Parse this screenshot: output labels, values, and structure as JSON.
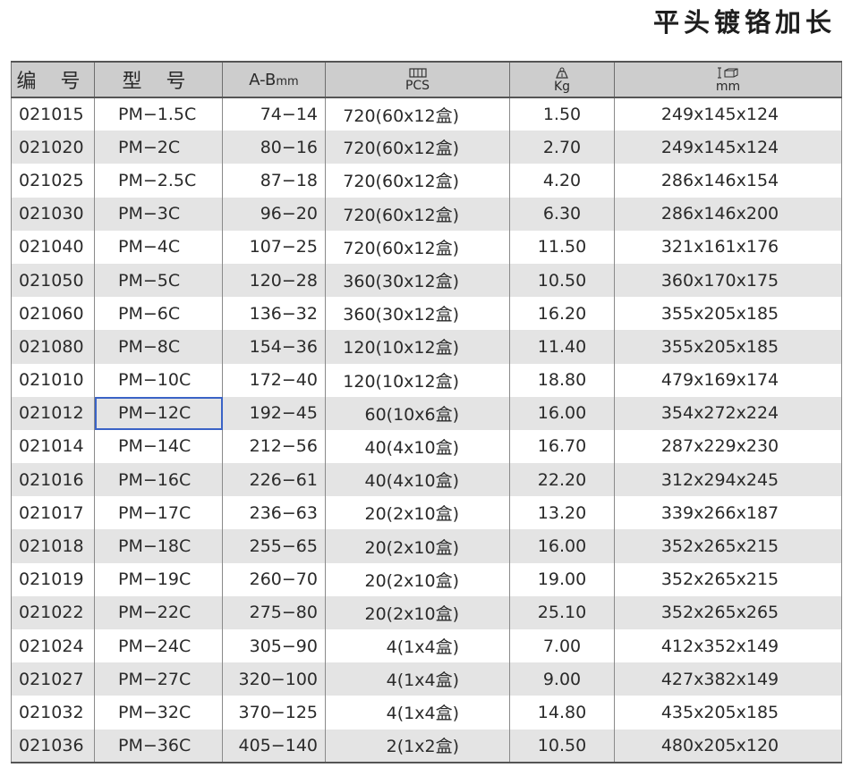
{
  "title": "平头镀铬加长",
  "headers": {
    "code": "编 号",
    "model": "型 号",
    "range_main": "A-B",
    "range_unit": "mm",
    "pcs_icon": "box-stack-icon",
    "pcs": "PCS",
    "kg_icon": "weight-icon",
    "kg": "Kg",
    "dims_icon": "carton-size-icon",
    "dims": "mm"
  },
  "selected_row": 9,
  "rows": [
    {
      "code": "021015",
      "model": "PM−1.5C",
      "range": "74−14",
      "pcs": "720(60x12盒)",
      "kg": "1.50",
      "dims": "249x145x124"
    },
    {
      "code": "021020",
      "model": "PM−2C",
      "range": "80−16",
      "pcs": "720(60x12盒)",
      "kg": "2.70",
      "dims": "249x145x124"
    },
    {
      "code": "021025",
      "model": "PM−2.5C",
      "range": "87−18",
      "pcs": "720(60x12盒)",
      "kg": "4.20",
      "dims": "286x146x154"
    },
    {
      "code": "021030",
      "model": "PM−3C",
      "range": "96−20",
      "pcs": "720(60x12盒)",
      "kg": "6.30",
      "dims": "286x146x200"
    },
    {
      "code": "021040",
      "model": "PM−4C",
      "range": "107−25",
      "pcs": "720(60x12盒)",
      "kg": "11.50",
      "dims": "321x161x176"
    },
    {
      "code": "021050",
      "model": "PM−5C",
      "range": "120−28",
      "pcs": "360(30x12盒)",
      "kg": "10.50",
      "dims": "360x170x175"
    },
    {
      "code": "021060",
      "model": "PM−6C",
      "range": "136−32",
      "pcs": "360(30x12盒)",
      "kg": "16.20",
      "dims": "355x205x185"
    },
    {
      "code": "021080",
      "model": "PM−8C",
      "range": "154−36",
      "pcs": "120(10x12盒)",
      "kg": "11.40",
      "dims": "355x205x185"
    },
    {
      "code": "021010",
      "model": "PM−10C",
      "range": "172−40",
      "pcs": "120(10x12盒)",
      "kg": "18.80",
      "dims": "479x169x174"
    },
    {
      "code": "021012",
      "model": "PM−12C",
      "range": "192−45",
      "pcs": "60(10x6盒)",
      "kg": "16.00",
      "dims": "354x272x224"
    },
    {
      "code": "021014",
      "model": "PM−14C",
      "range": "212−56",
      "pcs": "40(4x10盒)",
      "kg": "16.70",
      "dims": "287x229x230"
    },
    {
      "code": "021016",
      "model": "PM−16C",
      "range": "226−61",
      "pcs": "40(4x10盒)",
      "kg": "22.20",
      "dims": "312x294x245"
    },
    {
      "code": "021017",
      "model": "PM−17C",
      "range": "236−63",
      "pcs": "20(2x10盒)",
      "kg": "13.20",
      "dims": "339x266x187"
    },
    {
      "code": "021018",
      "model": "PM−18C",
      "range": "255−65",
      "pcs": "20(2x10盒)",
      "kg": "16.00",
      "dims": "352x265x215"
    },
    {
      "code": "021019",
      "model": "PM−19C",
      "range": "260−70",
      "pcs": "20(2x10盒)",
      "kg": "19.00",
      "dims": "352x265x215"
    },
    {
      "code": "021022",
      "model": "PM−22C",
      "range": "275−80",
      "pcs": "20(2x10盒)",
      "kg": "25.10",
      "dims": "352x265x265"
    },
    {
      "code": "021024",
      "model": "PM−24C",
      "range": "305−90",
      "pcs": "4(1x4盒)",
      "kg": "7.00",
      "dims": "412x352x149"
    },
    {
      "code": "021027",
      "model": "PM−27C",
      "range": "320−100",
      "pcs": "4(1x4盒)",
      "kg": "9.00",
      "dims": "427x382x149"
    },
    {
      "code": "021032",
      "model": "PM−32C",
      "range": "370−125",
      "pcs": "4(1x4盒)",
      "kg": "14.80",
      "dims": "435x205x185"
    },
    {
      "code": "021036",
      "model": "PM−36C",
      "range": "405−140",
      "pcs": "2(1x2盒)",
      "kg": "10.50",
      "dims": "480x205x120"
    }
  ]
}
